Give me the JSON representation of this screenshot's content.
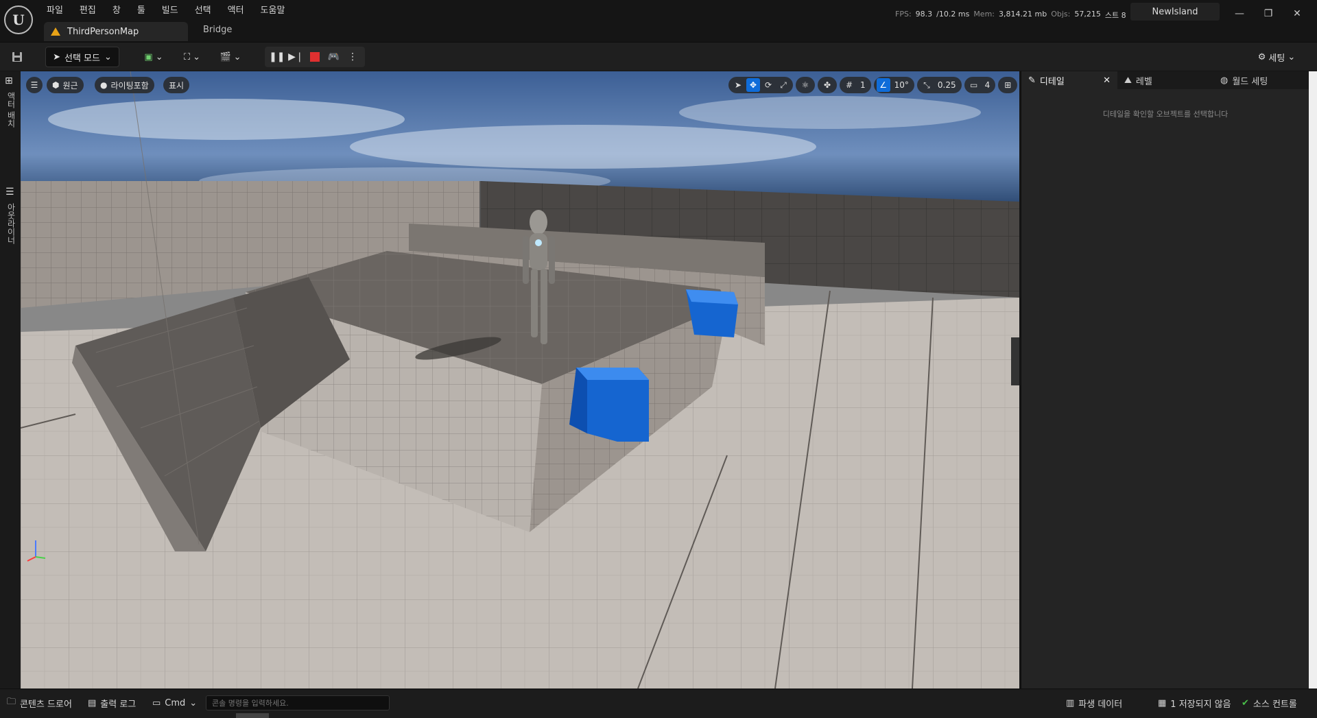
{
  "app": {
    "logo_text": "U",
    "menu": [
      "파일",
      "편집",
      "창",
      "툴",
      "빌드",
      "선택",
      "액터",
      "도움말"
    ],
    "tabs": [
      {
        "label": "ThirdPersonMap",
        "active": true,
        "warning": true
      },
      {
        "label": "Bridge",
        "active": false
      }
    ],
    "stats": {
      "fps_label": "FPS:",
      "fps": "98.3",
      "ms": "/10.2 ms",
      "mem_label": "Mem:",
      "mem": "3,814.21 mb",
      "objs_label": "Objs:",
      "objs": "57,215",
      "streams": "스트 8"
    },
    "project_name": "NewIsland"
  },
  "toolbar": {
    "mode_select": "선택 모드",
    "settings_label": "세팅"
  },
  "left_strip": {
    "place_actors": "액터 배치",
    "outliner": "아웃라이너"
  },
  "viewport": {
    "perspective_label": "원근",
    "lighting_label": "라이팅포함",
    "show_label": "표시",
    "grid_snap": "1",
    "angle_snap": "10°",
    "scale_snap": "0.25",
    "camera_speed": "4",
    "accent": "#0f6cd9"
  },
  "details_panel": {
    "tabs": [
      {
        "label": "디테일",
        "active": true,
        "closable": true
      },
      {
        "label": "레벨",
        "active": false
      },
      {
        "label": "월드 세팅",
        "active": false
      }
    ],
    "empty_message": "디테일을 확인할 오브젝트를 선택합니다"
  },
  "statusbar": {
    "content_drawer": "콘텐츠 드로어",
    "output_log": "출력 로그",
    "cmd_label": "Cmd",
    "cmd_placeholder": "콘솔 명령을 입력하세요.",
    "derived_data": "파생 데이터",
    "unsaved": "1 저장되지 않음",
    "source_control": "소스 컨트롤"
  }
}
